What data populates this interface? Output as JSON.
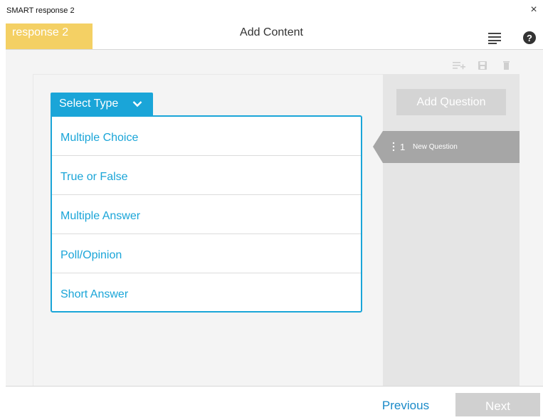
{
  "window": {
    "title": "SMART response 2",
    "close_glyph": "×"
  },
  "header": {
    "brand": "response 2",
    "title": "Add Content",
    "brand_color": "#f4d064",
    "menu_icon": "menu-lines-icon",
    "help_icon": "help-circle-icon"
  },
  "toolbar": {
    "icons": [
      "add-list-icon",
      "save-icon",
      "delete-icon"
    ]
  },
  "select_type": {
    "label": "Select Type",
    "accent_color": "#1aa5d8",
    "options": [
      "Multiple Choice",
      "True or False",
      "Multiple Answer",
      "Poll/Opinion",
      "Short Answer"
    ]
  },
  "questions": {
    "add_label": "Add Question",
    "items": [
      {
        "number": "1",
        "label": "New Question"
      }
    ]
  },
  "footer": {
    "previous_label": "Previous",
    "next_label": "Next"
  }
}
